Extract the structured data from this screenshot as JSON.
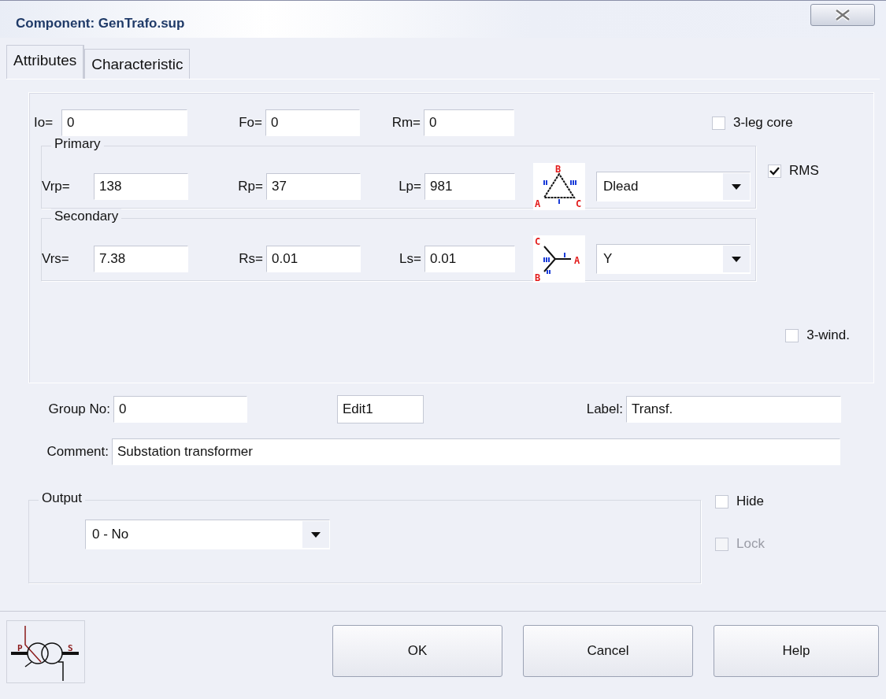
{
  "window": {
    "title": "Component: GenTrafo.sup"
  },
  "tabs": [
    {
      "label": "Attributes",
      "selected": true
    },
    {
      "label": "Characteristic",
      "selected": false
    }
  ],
  "core": {
    "fields": [
      {
        "label": "Io=",
        "value": "0"
      },
      {
        "label": "Fo=",
        "value": "0"
      },
      {
        "label": "Rm=",
        "value": "0"
      }
    ],
    "three_leg_core": {
      "label": "3-leg core",
      "checked": false,
      "disabled": false
    }
  },
  "windings": [
    {
      "title": "Primary",
      "fields": [
        {
          "label": "Vrp=",
          "value": "138"
        },
        {
          "label": "Rp=",
          "value": "37"
        },
        {
          "label": "Lp=",
          "value": "981"
        }
      ],
      "connection": {
        "kind": "delta",
        "phases": [
          "A",
          "B",
          "C"
        ],
        "value": "Dlead"
      },
      "option": {
        "label": "RMS",
        "checked": true,
        "disabled": false
      }
    },
    {
      "title": "Secondary",
      "fields": [
        {
          "label": "Vrs=",
          "value": "7.38"
        },
        {
          "label": "Rs=",
          "value": "0.01"
        },
        {
          "label": "Ls=",
          "value": "0.01"
        }
      ],
      "connection": {
        "kind": "wye",
        "phases": [
          "A",
          "B",
          "C"
        ],
        "value": "Y"
      }
    }
  ],
  "three_wind": {
    "label": "3-wind.",
    "checked": false,
    "disabled": false
  },
  "group_no": {
    "label": "Group No:",
    "value": "0"
  },
  "edit1": {
    "value": "Edit1"
  },
  "label_field": {
    "label": "Label:",
    "value": "Transf."
  },
  "comment": {
    "label": "Comment:",
    "value": "Substation transformer"
  },
  "output": {
    "title": "Output",
    "value": "0 - No"
  },
  "hide": {
    "label": "Hide",
    "checked": false,
    "disabled": false
  },
  "lock": {
    "label": "Lock",
    "checked": false,
    "disabled": true
  },
  "symbol": {
    "labels": [
      "P",
      "S"
    ]
  },
  "buttons": [
    {
      "label": "OK"
    },
    {
      "label": "Cancel"
    },
    {
      "label": "Help"
    }
  ]
}
